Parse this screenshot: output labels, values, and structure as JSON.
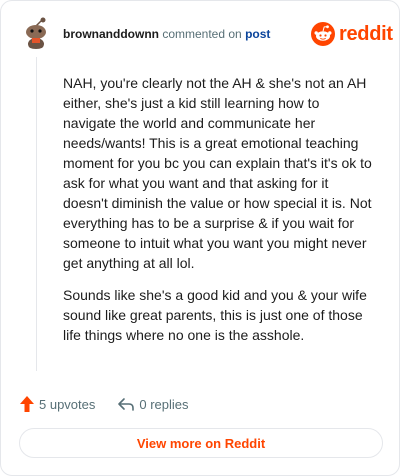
{
  "header": {
    "author": "brownanddownn",
    "verb": "commented on",
    "post_link": "post",
    "logo_text": "reddit"
  },
  "comment": {
    "paragraphs": [
      "NAH, you're clearly not the AH & she's not an AH either, she's just a kid still learning how to navigate the world and communicate her needs/wants! This is a great emotional teaching moment for you bc you can explain that's it's ok to ask for what you want and that asking for it doesn't diminish the value or how special it is. Not everything has to be a surprise & if you wait for someone to intuit what you want you might never get anything at all lol.",
      "Sounds like she's a good kid and you & your wife sound like great parents, this is just one of those life things where no one is the asshole."
    ]
  },
  "actions": {
    "upvotes": "5 upvotes",
    "replies": "0 replies"
  },
  "view_more": "View more on Reddit",
  "colors": {
    "brand": "#ff4500",
    "link": "#0a449b",
    "muted": "#576f76"
  },
  "icons": [
    "snoo-avatar-icon",
    "reddit-logo-icon",
    "upvote-arrow-icon",
    "reply-arrow-icon"
  ]
}
